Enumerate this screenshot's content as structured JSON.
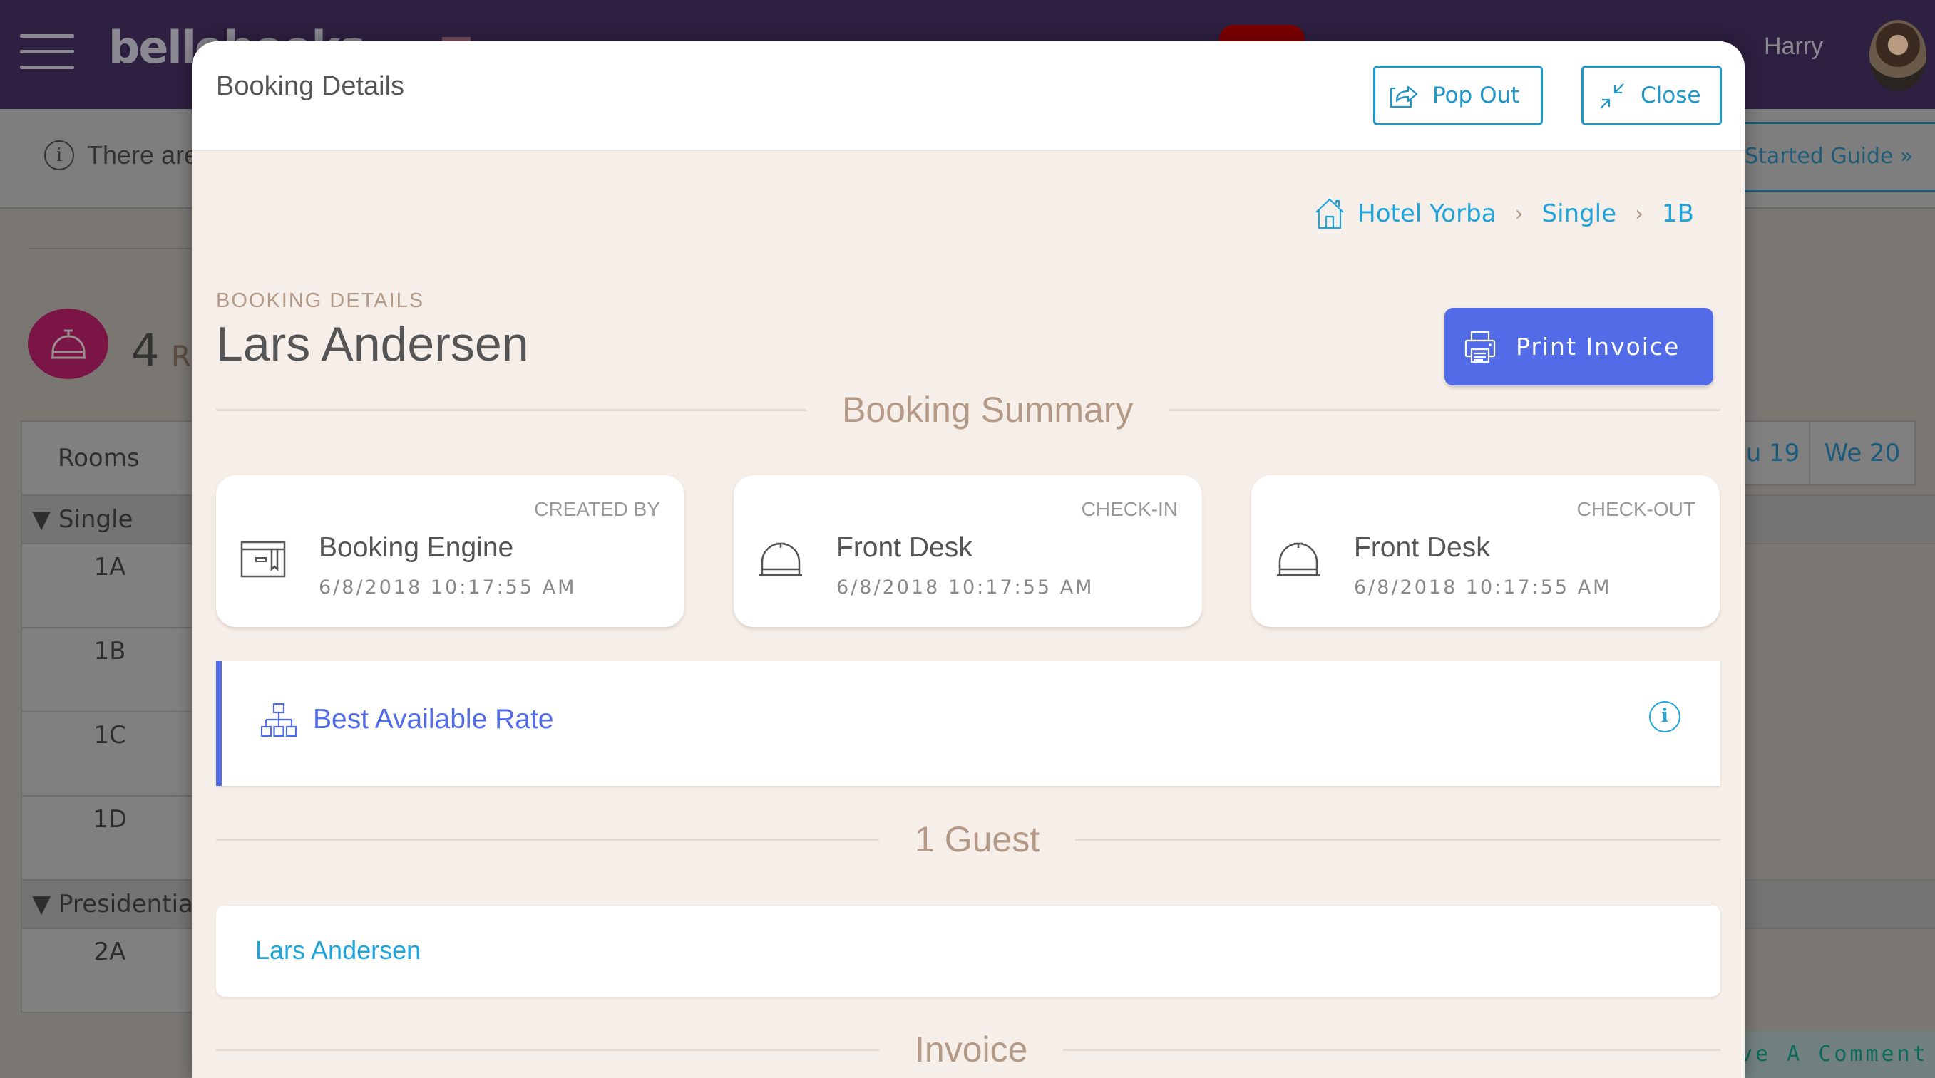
{
  "app": {
    "logo_text": "bellebooks",
    "nav_user": "Harry",
    "info_text": "There are",
    "guide_button": "Started Guide »",
    "rooms_count": "4",
    "rooms_count_suffix": "R",
    "leave_comment": "ve A Comment"
  },
  "grid": {
    "header": "Rooms",
    "groups": [
      {
        "name": "Single",
        "toggle": "▼",
        "rooms": [
          "1A",
          "1B",
          "1C",
          "1D"
        ]
      },
      {
        "name": "Presidential",
        "toggle": "▼",
        "rooms": [
          "2A"
        ]
      }
    ],
    "day_headers": [
      "u 19",
      "We 20"
    ]
  },
  "modal": {
    "title": "Booking Details",
    "pop_out_label": "Pop Out",
    "close_label": "Close",
    "breadcrumb": [
      "Hotel Yorba",
      "Single",
      "1B"
    ],
    "breadcrumb_sep": "›",
    "eyebrow": "BOOKING DETAILS",
    "guest_name": "Lars Andersen",
    "print_invoice_label": "Print Invoice",
    "sections": {
      "summary": "Booking Summary",
      "guests": "1 Guest",
      "invoice": "Invoice"
    },
    "cards": [
      {
        "label": "CREATED BY",
        "who": "Booking Engine",
        "when": "6/8/2018 10:17:55 AM",
        "icon": "booking-engine-icon"
      },
      {
        "label": "CHECK-IN",
        "who": "Front Desk",
        "when": "6/8/2018 10:17:55 AM",
        "icon": "bell-icon"
      },
      {
        "label": "CHECK-OUT",
        "who": "Front Desk",
        "when": "6/8/2018 10:17:55 AM",
        "icon": "bell-icon"
      }
    ],
    "rate": {
      "name": "Best Available Rate",
      "info_glyph": "i"
    },
    "guests": [
      "Lars Andersen"
    ]
  },
  "colors": {
    "accent_blue": "#526be6",
    "link_blue": "#1ea5dc",
    "header_button": "#2196c9",
    "modal_bg": "#f6eee9",
    "muted_tan": "#b49a86",
    "nav_bg": "#2e2040"
  }
}
